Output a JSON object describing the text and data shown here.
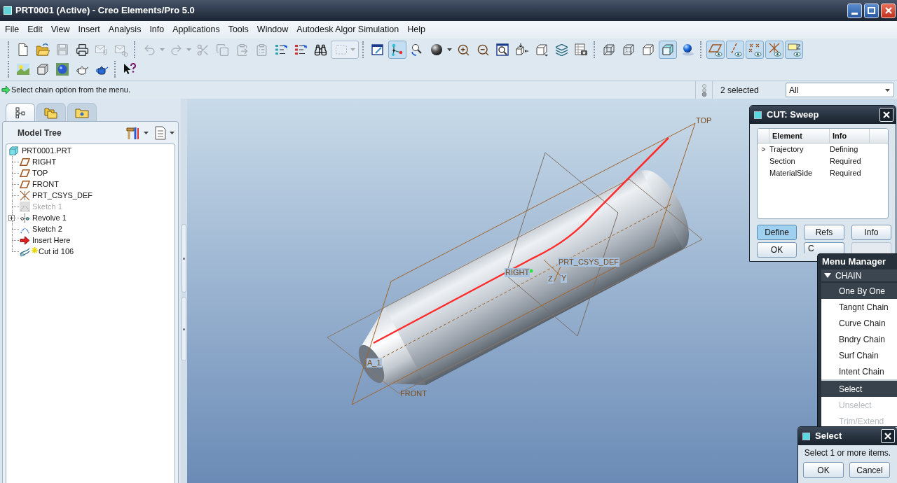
{
  "window": {
    "title": "PRT0001 (Active) - Creo Elements/Pro 5.0"
  },
  "menu_bar": [
    "File",
    "Edit",
    "View",
    "Insert",
    "Analysis",
    "Info",
    "Applications",
    "Tools",
    "Window",
    "Autodesk Algor Simulation",
    "Help"
  ],
  "toolbars": [
    {
      "groups": [
        [
          {
            "on": false,
            "disabled": false
          },
          {
            "on": false,
            "disabled": false
          },
          {
            "on": false,
            "disabled": true
          },
          {
            "on": false,
            "disabled": false
          },
          {
            "on": false,
            "disabled": true
          },
          {
            "on": false,
            "disabled": true
          }
        ],
        [
          {
            "on": false,
            "disabled": true
          },
          {
            "on": false,
            "disabled": true
          },
          {
            "on": false,
            "disabled": true
          },
          {
            "on": false,
            "disabled": true
          },
          {
            "on": false,
            "disabled": true
          },
          {
            "on": false,
            "disabled": true
          },
          {
            "on": false,
            "disabled": false
          },
          {
            "on": false,
            "disabled": false
          },
          {
            "on": false,
            "disabled": false
          },
          {
            "on": false,
            "disabled": true
          }
        ],
        [
          {
            "on": false,
            "disabled": false
          },
          {
            "on": true,
            "disabled": false
          },
          {
            "on": false,
            "disabled": false
          },
          {
            "on": false,
            "disabled": false
          },
          {
            "on": false,
            "disabled": false
          },
          {
            "on": false,
            "disabled": false
          },
          {
            "on": false,
            "disabled": false
          },
          {
            "on": false,
            "disabled": false
          },
          {
            "on": false,
            "disabled": false
          },
          {
            "on": false,
            "disabled": false
          },
          {
            "on": false,
            "disabled": false
          }
        ],
        [
          {
            "on": false,
            "disabled": false
          },
          {
            "on": false,
            "disabled": false
          },
          {
            "on": false,
            "disabled": false
          },
          {
            "on": true,
            "disabled": false
          },
          {
            "on": false,
            "disabled": false
          }
        ],
        [
          {
            "on": true,
            "disabled": false
          },
          {
            "on": true,
            "disabled": false
          },
          {
            "on": true,
            "disabled": false
          },
          {
            "on": true,
            "disabled": false
          },
          {
            "on": true,
            "disabled": false
          }
        ]
      ]
    },
    {
      "groups": [
        [
          {
            "on": false,
            "disabled": false
          },
          {
            "on": false,
            "disabled": false
          },
          {
            "on": false,
            "disabled": false
          },
          {
            "on": false,
            "disabled": false
          },
          {
            "on": false,
            "disabled": false
          }
        ],
        [
          {
            "on": false,
            "disabled": false
          }
        ]
      ]
    }
  ],
  "message_area": {
    "message": "Select chain option from the menu."
  },
  "selection": {
    "count": "2 selected",
    "filter": "All"
  },
  "navigator": {
    "tabs": [
      {
        "selected": true
      },
      {
        "selected": false
      },
      {
        "selected": false
      }
    ],
    "title": "Model Tree",
    "tree": [
      {
        "label": "PRT0001.PRT",
        "kind": "part",
        "disabled": false,
        "collapsed": false,
        "creating": false,
        "children": [
          {
            "label": "RIGHT",
            "kind": "plane",
            "disabled": false,
            "collapsed": false,
            "creating": false
          },
          {
            "label": "TOP",
            "kind": "plane",
            "disabled": false,
            "collapsed": false,
            "creating": false
          },
          {
            "label": "FRONT",
            "kind": "plane",
            "disabled": false,
            "collapsed": false,
            "creating": false
          },
          {
            "label": "PRT_CSYS_DEF",
            "kind": "csys",
            "disabled": false,
            "collapsed": false,
            "creating": false
          },
          {
            "label": "Sketch 1",
            "kind": "sketch",
            "disabled": true,
            "collapsed": false,
            "creating": false
          },
          {
            "label": "Revolve 1",
            "kind": "revolve",
            "disabled": false,
            "collapsed": true,
            "creating": false
          },
          {
            "label": "Sketch 2",
            "kind": "sketch",
            "disabled": false,
            "collapsed": false,
            "creating": false
          },
          {
            "label": "Insert Here",
            "kind": "insert",
            "disabled": false,
            "collapsed": false,
            "creating": false
          },
          {
            "label": "Cut id 106",
            "kind": "sweep",
            "disabled": false,
            "collapsed": false,
            "creating": true
          }
        ]
      }
    ]
  },
  "graphics": {
    "labels": [
      {
        "text": "TOP",
        "highlighted": false
      },
      {
        "text": "PRT_CSYS_DEF",
        "highlighted": true
      },
      {
        "text": "RIGHT",
        "highlighted": true
      },
      {
        "text": "Z",
        "highlighted": true
      },
      {
        "text": "Y",
        "highlighted": true
      },
      {
        "text": "A_1",
        "highlighted": true
      },
      {
        "text": "FRONT",
        "highlighted": false
      }
    ]
  },
  "sweep_dialog": {
    "title": "CUT: Sweep",
    "columns": [
      "Element",
      "Info"
    ],
    "rows": [
      {
        "marker": ">",
        "element": "Trajectory",
        "info": "Defining"
      },
      {
        "element": "Section",
        "info": "Required"
      },
      {
        "element": "MaterialSide",
        "info": "Required"
      }
    ],
    "buttons": [
      {
        "label": "Define",
        "active": true,
        "disabled": false
      },
      {
        "label": "Refs",
        "active": false,
        "disabled": false
      },
      {
        "label": "Info",
        "active": false,
        "disabled": false
      },
      {
        "label": "OK",
        "active": false,
        "disabled": false
      },
      {
        "label": "C",
        "active": false,
        "disabled": false
      },
      {
        "active": false,
        "disabled": true
      }
    ]
  },
  "menu_manager": {
    "title": "Menu Manager",
    "menu": {
      "title": "CHAIN",
      "expanded": true,
      "groups": [
        [
          {
            "label": "One By One",
            "selected": true,
            "disabled": false
          },
          {
            "label": "Tangnt Chain",
            "selected": false,
            "disabled": false
          },
          {
            "label": "Curve Chain",
            "selected": false,
            "disabled": false
          },
          {
            "label": "Bndry Chain",
            "selected": false,
            "disabled": false
          },
          {
            "label": "Surf Chain",
            "selected": false,
            "disabled": false
          },
          {
            "label": "Intent Chain",
            "selected": false,
            "disabled": false
          }
        ],
        [
          {
            "label": "Select",
            "selected": true,
            "disabled": false
          },
          {
            "label": "Unselect",
            "selected": false,
            "disabled": true
          },
          {
            "label": "Trim/Extend",
            "selected": false,
            "disabled": true
          }
        ]
      ]
    }
  },
  "select_dialog": {
    "title": "Select",
    "message": "Select 1 or more items.",
    "buttons": [
      "OK",
      "Cancel"
    ]
  }
}
